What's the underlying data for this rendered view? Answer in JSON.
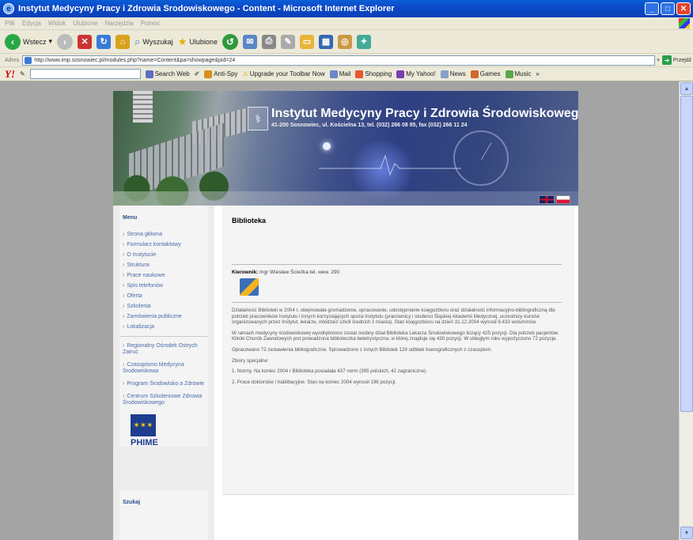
{
  "window": {
    "title": "Instytut Medycyny Pracy i Zdrowia Środowiskowego - Content - Microsoft Internet Explorer",
    "minimize": "_",
    "maximize": "□",
    "close": "✕"
  },
  "menubar": [
    "Plik",
    "Edycja",
    "Widok",
    "Ulubione",
    "Narzędzia",
    "Pomoc"
  ],
  "toolbar": {
    "back_label": "Wstecz",
    "search_label": "Wyszukaj",
    "favorites_label": "Ulubione"
  },
  "address": {
    "label": "Adres",
    "url": "http://www.imp.sosnowiec.pl/modules.php?name=Content&pa=showpage&pid=24",
    "go_label": "Przejdź"
  },
  "yahoo": {
    "logo": "Y!",
    "search_web": "Search Web",
    "antispy": "Anti-Spy",
    "upgrade": "Upgrade your Toolbar Now",
    "mail": "Mail",
    "shopping": "Shopping",
    "myyahoo": "My Yahoo!",
    "news": "News",
    "games": "Games",
    "music": "Music",
    "more": "»"
  },
  "banner": {
    "name": "Instytut Medycyny Pracy i Zdrowia Środowiskowego",
    "address": "41-200 Sosnowiec, ul. Kościelna 13, tel. (032) 266 08 85, fax (032) 266 11 24"
  },
  "sidebar": {
    "menu_title": "Menu",
    "items": [
      "Strona główna",
      "Formularz kontaktowy",
      "O Instytucie",
      "Struktura",
      "Prace naukowe",
      "Spis telefonów",
      "Oferta",
      "Szkolenia",
      "Zamówienia publiczne",
      "Lokalizacja"
    ],
    "links": [
      "Regionalny Ośrodek Ostrych Zatruć",
      "Czasopismo Medycyna Środowiskowa",
      "Program Środowisko a Zdrowie",
      "Centrum Szkoleniowe Zdrowia Środowiskowego"
    ],
    "phime": "PHIME",
    "search_title": "Szukaj"
  },
  "content": {
    "title": "Biblioteka",
    "manager_label": "Kierownik:",
    "manager_value": "mgr Wiesław Ścieżka tel. wew. 290",
    "paragraphs": [
      "Działalność Biblioteki w 2004 r. obejmowała gromadzenie, opracowanie, udostępnianie księgozbioru oraz działalność informacyjno-bibliograficzną dla potrzeb pracowników Instytutu i innych korzystających spoza Instytutu (pracownicy i studenci Śląskiej Akademii Medycznej, uczestnicy kursów organizowanych przez Instytut, lekarze, młodzież szkół średnich z miasta). Stan księgozbioru na dzień 31.12.2004 wynosił 9.433 woluminów.",
      "W ramach medycyny środowiskowej wyodrębniono został osobny dział Biblioteka Lekarza Środowiskowego liczący 425 pozycji. Dla potrzeb pacjentów Kliniki Chorób Zawodowych jest prowadzona biblioteczka beletrystyczna, w której znajduje się 430 pozycji. W ubiegłym roku wypożyczono 72 pozycje.",
      "Opracowano 72 zestawienia bibliograficzne. Sprowadzono z innych Bibliotek 129 odbitek kserograficznych z czasopism.",
      "Zbiory specjalne:",
      "1. Normy. Na koniec 2004 r Biblioteka posiadała 437 norm (395 polskich, 42 zagraniczne).",
      "2. Prace doktorskie i habilitacyjne. Stan na koniec 2004 wynosił 196 pozycji."
    ]
  },
  "colors": {
    "titlebar": "#0b4ac7",
    "link": "#4a6aa8",
    "viewport_bg": "#a4a4a4"
  }
}
